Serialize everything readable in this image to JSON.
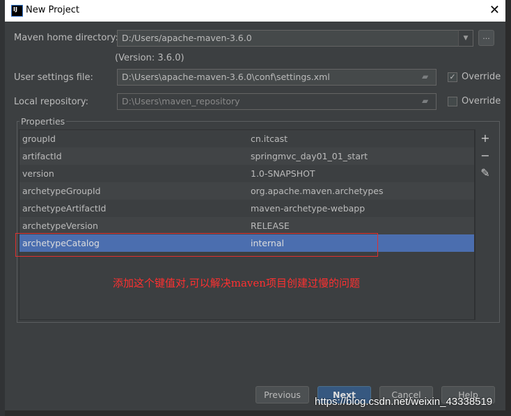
{
  "window": {
    "title": "New Project",
    "logo": "IJ"
  },
  "form": {
    "maven_home_label": "Maven home directory:",
    "maven_home_value": "D:/Users/apache-maven-3.6.0",
    "version_text": "(Version: 3.6.0)",
    "user_settings_label": "User settings file:",
    "user_settings_value": "D:\\Users\\apache-maven-3.6.0\\conf\\settings.xml",
    "user_settings_override": {
      "label": "Override",
      "checked": true
    },
    "local_repo_label": "Local repository:",
    "local_repo_value": "D:\\Users\\maven_repository",
    "local_repo_override": {
      "label": "Override",
      "checked": false
    },
    "browse_label": "..."
  },
  "properties": {
    "title": "Properties",
    "rows": [
      {
        "key": "groupId",
        "value": "cn.itcast"
      },
      {
        "key": "artifactId",
        "value": "springmvc_day01_01_start"
      },
      {
        "key": "version",
        "value": "1.0-SNAPSHOT"
      },
      {
        "key": "archetypeGroupId",
        "value": "org.apache.maven.archetypes"
      },
      {
        "key": "archetypeArtifactId",
        "value": "maven-archetype-webapp"
      },
      {
        "key": "archetypeVersion",
        "value": "RELEASE"
      },
      {
        "key": "archetypeCatalog",
        "value": "internal",
        "selected": true
      }
    ],
    "tools": [
      "plus-icon",
      "minus-icon",
      "pencil-icon"
    ]
  },
  "annotation": {
    "text": "添加这个键值对,可以解决maven项目创建过慢的问题",
    "color": "#ff3030"
  },
  "buttons": {
    "previous": "Previous",
    "next": "Next",
    "cancel": "Cancel",
    "help": "Help"
  },
  "watermark": "https://blog.csdn.net/weixin_43338519",
  "colors": {
    "background": "#3c3f41",
    "selection": "#4b6eaf",
    "primary_button": "#365880"
  }
}
